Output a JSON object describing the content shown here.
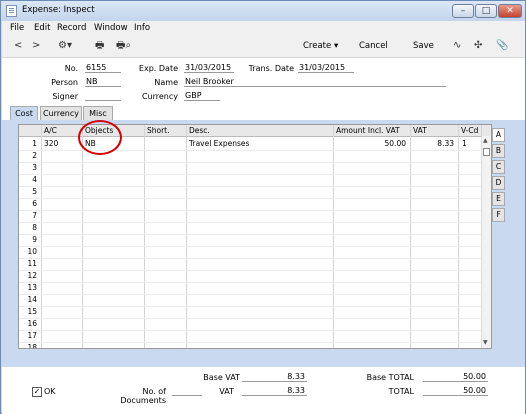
{
  "window": {
    "title": "Expense: Inspect"
  },
  "menu": [
    "File",
    "Edit",
    "Record",
    "Window",
    "Info"
  ],
  "toolbar": {
    "create_label": "Create",
    "cancel_label": "Cancel",
    "save_label": "Save"
  },
  "header": {
    "no_label": "No.",
    "no_value": "6155",
    "person_label": "Person",
    "person_value": "NB",
    "signer_label": "Signer",
    "signer_value": "",
    "exp_date_label": "Exp. Date",
    "exp_date_value": "31/03/2015",
    "name_label": "Name",
    "name_value": "Neil Brooker",
    "currency_label": "Currency",
    "currency_value": "GBP",
    "trans_date_label": "Trans. Date",
    "trans_date_value": "31/03/2015"
  },
  "tabs": [
    "Cost",
    "Currency",
    "Misc"
  ],
  "grid": {
    "columns": [
      "A/C",
      "Objects",
      "Short.",
      "Desc.",
      "Amount Incl. VAT",
      "VAT",
      "V-Cd"
    ],
    "row_numbers": [
      "1",
      "2",
      "3",
      "4",
      "5",
      "6",
      "7",
      "8",
      "9",
      "10",
      "11",
      "12",
      "13",
      "14",
      "15",
      "16",
      "17",
      "18"
    ],
    "rows": [
      {
        "ac": "320",
        "objects": "NB",
        "short": "",
        "desc": "Travel Expenses",
        "amount": "50.00",
        "vat": "8.33",
        "vcd": "1"
      }
    ]
  },
  "side_tabs": [
    "A",
    "B",
    "C",
    "D",
    "E",
    "F"
  ],
  "footer": {
    "ok_label": "OK",
    "ok_checked": true,
    "no_of_documents_label": "No. of Documents",
    "no_of_documents_value": "",
    "base_vat_label": "Base VAT",
    "base_vat_value": "8.33",
    "vat_label": "VAT",
    "vat_value": "8.33",
    "base_total_label": "Base TOTAL",
    "base_total_value": "50.00",
    "total_label": "TOTAL",
    "total_value": "50.00"
  },
  "colors": {
    "panel": "#c9daf0",
    "highlight_circle": "#d40000"
  }
}
